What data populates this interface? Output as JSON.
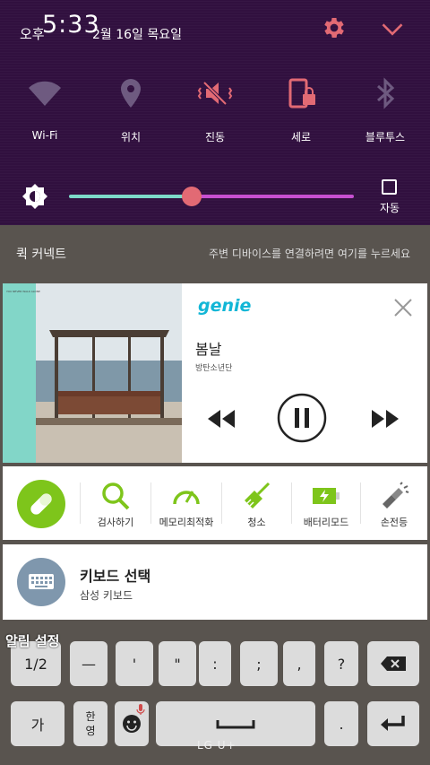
{
  "status": {
    "ampm": "오후",
    "time": "5:33",
    "date": "2월 16일 목요일"
  },
  "quick_settings": {
    "toggles": [
      {
        "label": "Wi-Fi",
        "icon": "wifi-icon"
      },
      {
        "label": "위치",
        "icon": "location-icon"
      },
      {
        "label": "진동",
        "icon": "vibrate-icon"
      },
      {
        "label": "세로",
        "icon": "rotation-lock-icon"
      },
      {
        "label": "블루투스",
        "icon": "bluetooth-icon"
      }
    ],
    "brightness_level": 0.43,
    "auto_label": "자동",
    "colors": {
      "icon_accent": "#e26a74",
      "panel_bg": "#31103f"
    }
  },
  "quick_connect": {
    "title": "퀵 커넥트",
    "hint": "주변 디바이스를 연결하려면 여기를 누르세요"
  },
  "music": {
    "app": "genie",
    "song": "봄날",
    "artist": "방탄소년단",
    "state": "playing"
  },
  "tools": [
    {
      "label": "검사하기",
      "icon": "search-icon"
    },
    {
      "label": "메모리최적화",
      "icon": "gauge-icon"
    },
    {
      "label": "청소",
      "icon": "broom-icon"
    },
    {
      "label": "배터리모드",
      "icon": "battery-icon"
    },
    {
      "label": "손전등",
      "icon": "flashlight-icon"
    }
  ],
  "keyboard_notification": {
    "title": "키보드 선택",
    "subtitle": "삼성 키보드"
  },
  "notification_settings": "알림 설정",
  "keyboard": {
    "row1": [
      "1/2",
      "—",
      "'",
      "\"",
      ":",
      ";",
      ",",
      "?"
    ],
    "lang_top": "한",
    "lang_bottom": "영",
    "key_ga": "가",
    "dot": "."
  },
  "carrier": "LG U+"
}
